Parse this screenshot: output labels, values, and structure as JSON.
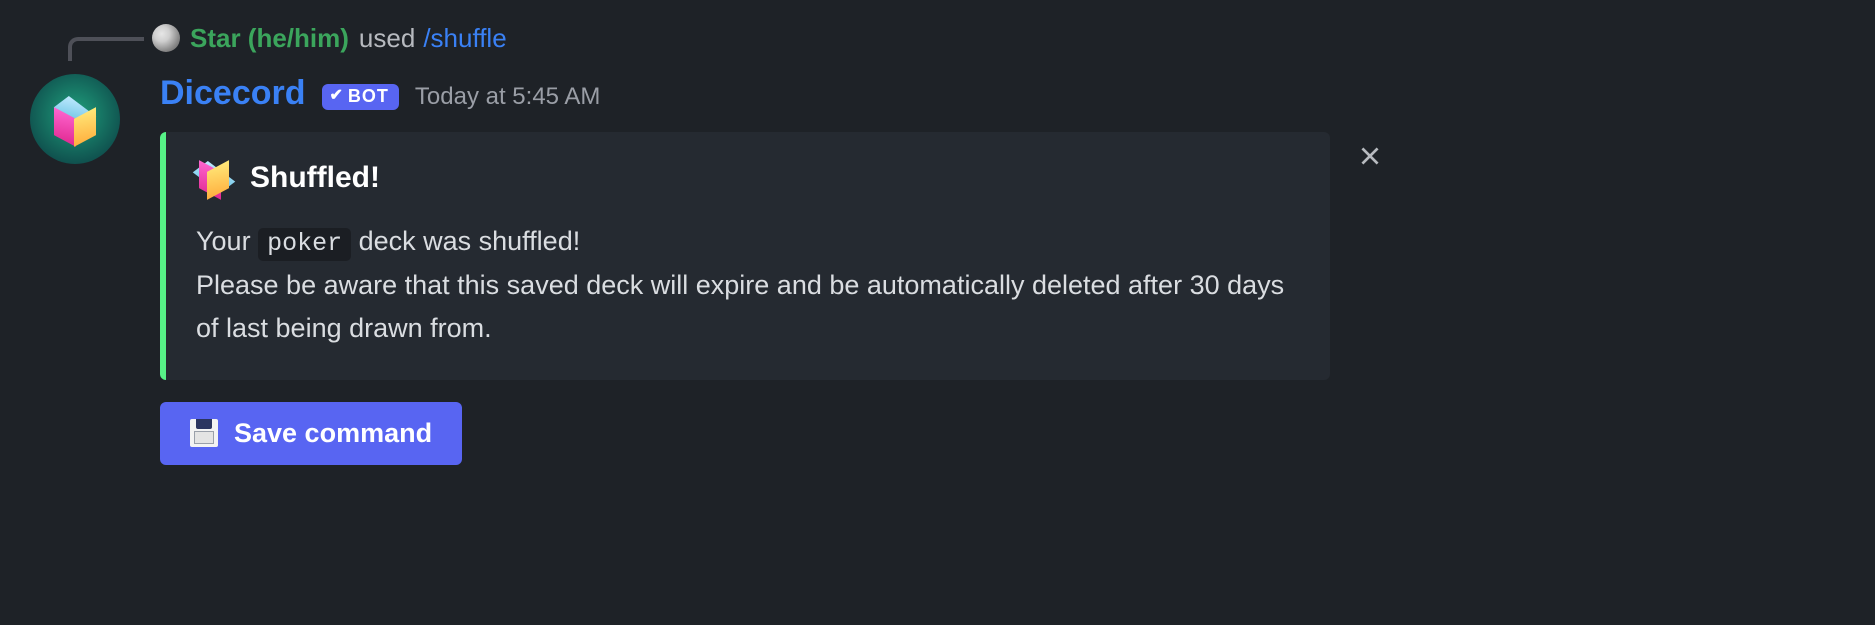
{
  "reply": {
    "username": "Star (he/him)",
    "action_text": "used",
    "command": "/shuffle"
  },
  "message": {
    "bot_name": "Dicecord",
    "bot_badge_text": "BOT",
    "timestamp": "Today at 5:45 AM"
  },
  "embed": {
    "title": "Shuffled!",
    "line1_prefix": "Your ",
    "line1_code": "poker",
    "line1_suffix": " deck was shuffled!",
    "body_rest": "Please be aware that this saved deck will expire and be automatically deleted after 30 days of last being drawn from."
  },
  "actions": {
    "save_label": "Save command"
  }
}
